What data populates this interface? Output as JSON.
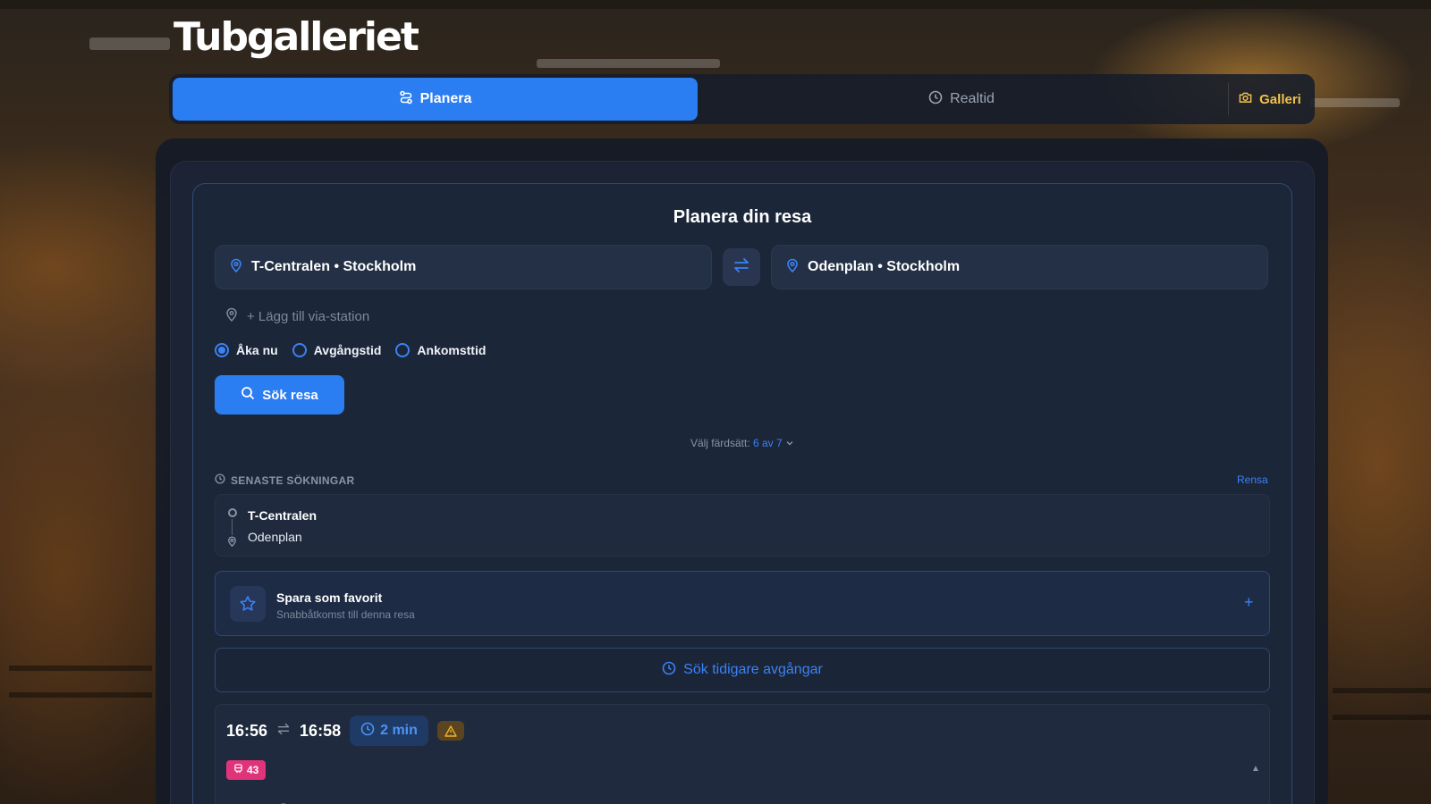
{
  "app": {
    "title": "Tubgalleriet"
  },
  "tabs": {
    "planera": "Planera",
    "realtid": "Realtid",
    "galleri": "Galleri"
  },
  "planner": {
    "heading": "Planera din resa",
    "from": "T-Centralen • Stockholm",
    "to": "Odenplan • Stockholm",
    "via_placeholder": "+ Lägg till via-station",
    "time_options": [
      {
        "label": "Åka nu",
        "selected": true
      },
      {
        "label": "Avgångstid",
        "selected": false
      },
      {
        "label": "Ankomsttid",
        "selected": false
      }
    ],
    "search_label": "Sök resa",
    "modes_label": "Välj färdsätt:",
    "modes_value": "6 av 7"
  },
  "recent": {
    "heading": "SENASTE SÖKNINGAR",
    "clear_label": "Rensa",
    "items": [
      {
        "from": "T-Centralen",
        "to": "Odenplan"
      }
    ]
  },
  "favorite": {
    "title": "Spara som favorit",
    "subtitle": "Snabbåtkomst till denna resa",
    "add": "+"
  },
  "earlier_label": "Sök tidigare avgångar",
  "results": [
    {
      "depart": "16:56",
      "arrive": "16:58",
      "duration": "2 min",
      "line": "43"
    }
  ],
  "colors": {
    "accent": "#2b7df2",
    "galleri": "#f1c24a",
    "line_badge": "#e0347a",
    "warning": "#f1b02b"
  },
  "icons": {
    "planera": "route-icon",
    "realtid": "clock-icon",
    "galleri": "camera-icon",
    "location": "map-pin-icon",
    "swap": "swap-arrows-icon",
    "search": "search-icon",
    "favorite": "star-icon",
    "warning": "warning-triangle-icon",
    "train": "train-icon"
  }
}
